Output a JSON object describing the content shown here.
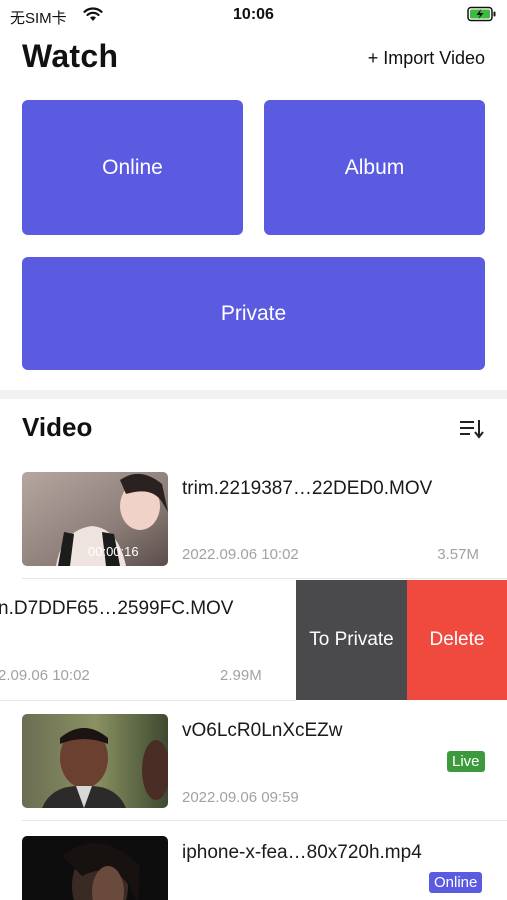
{
  "status_bar": {
    "carrier": "无SIM卡",
    "time": "10:06"
  },
  "header": {
    "title": "Watch",
    "import_label": "+ Import Video"
  },
  "tiles": {
    "online": "Online",
    "album": "Album",
    "private": "Private"
  },
  "colors": {
    "accent": "#5b5be2",
    "live_badge": "#3c9a3c",
    "delete": "#f04a3f",
    "to_private": "#4a4a4c"
  },
  "video_section": {
    "title": "Video",
    "items": [
      {
        "name": "trim.2219387…22DED0.MOV",
        "date": "2022.09.06 10:02",
        "size": "3.57M",
        "thumb_overlay": "00:00:16"
      },
      {
        "name": "n.D7DDF65…2599FC.MOV",
        "date": "2.09.06 10:02",
        "size": "2.99M"
      },
      {
        "name": "vO6LcR0LnXcEZw",
        "date": "2022.09.06 09:59",
        "badge": "Live"
      },
      {
        "name": "iphone-x-fea…80x720h.mp4",
        "badge": "Online"
      }
    ],
    "swipe_actions": {
      "to_private": "To Private",
      "delete": "Delete"
    }
  }
}
